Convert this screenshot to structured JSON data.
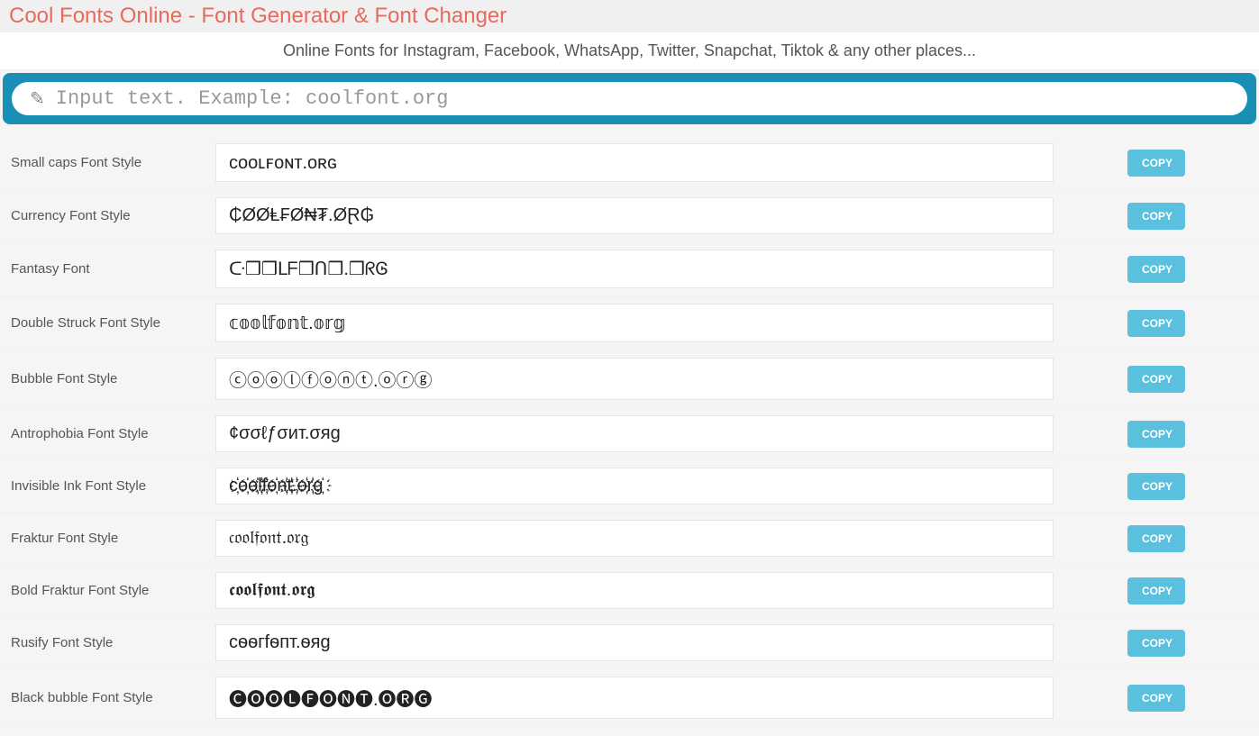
{
  "header": {
    "title": "Cool Fonts Online - Font Generator & Font Changer",
    "subtitle": "Online Fonts for Instagram, Facebook, WhatsApp, Twitter, Snapchat, Tiktok & any other places..."
  },
  "input": {
    "placeholder": "Input text. Example: coolfont.org",
    "value": ""
  },
  "copy_label": "COPY",
  "fonts": [
    {
      "label": "Small caps Font Style",
      "output": "ᴄᴏᴏʟꜰᴏɴᴛ.ᴏʀɢ"
    },
    {
      "label": "Currency Font Style",
      "output": "₵ØØⱠ₣Ø₦₮.ØⱤ₲"
    },
    {
      "label": "Fantasy Font",
      "output": "ᑢ❒❒ᒪᖴ❒ᑎ❒.❒ᖇᎶ"
    },
    {
      "label": "Double Struck Font Style",
      "output": "𝕔𝕠𝕠𝕝𝕗𝕠𝕟𝕥.𝕠𝕣𝕘"
    },
    {
      "label": "Bubble Font Style",
      "output": "ⓒⓞⓞⓛⓕⓞⓝⓣ.ⓞⓡⓖ"
    },
    {
      "label": "Antrophobia Font Style",
      "output": "¢σσℓƒσит.σяg"
    },
    {
      "label": "Invisible Ink Font Style",
      "output": "c҉o҉o҉l҉f҉o҉n҉t҉.҉o҉r҉g҉"
    },
    {
      "label": "Fraktur Font Style",
      "output": "𝔠𝔬𝔬𝔩𝔣𝔬𝔫𝔱.𝔬𝔯𝔤"
    },
    {
      "label": "Bold Fraktur Font Style",
      "output": "𝖈𝖔𝖔𝖑𝖋𝖔𝖓𝖙.𝖔𝖗𝖌"
    },
    {
      "label": "Rusify Font Style",
      "output": "cѳѳгfѳпт.ѳяg"
    },
    {
      "label": "Black bubble Font Style",
      "output": "🅒🅞🅞🅛🅕🅞🅝🅣.🅞🅡🅖"
    }
  ]
}
